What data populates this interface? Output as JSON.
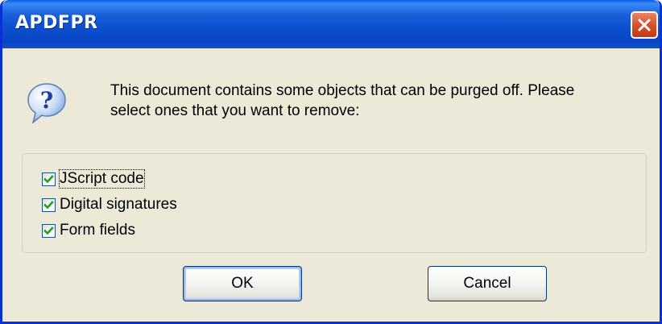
{
  "window": {
    "title": "APDFPR"
  },
  "dialog": {
    "message_line1": "This document contains some objects that can be purged off. Please",
    "message_line2": "select ones that you want to remove:",
    "icon": "question-icon"
  },
  "options": [
    {
      "label": "JScript code",
      "checked": true,
      "focused": true
    },
    {
      "label": "Digital signatures",
      "checked": true,
      "focused": false
    },
    {
      "label": "Form fields",
      "checked": true,
      "focused": false
    }
  ],
  "buttons": {
    "ok_label": "OK",
    "cancel_label": "Cancel"
  },
  "colors": {
    "titlebar": "#0b4ecf",
    "close_button": "#d8502b",
    "dialog_background": "#ece9d8",
    "checkmark": "#21a121"
  }
}
